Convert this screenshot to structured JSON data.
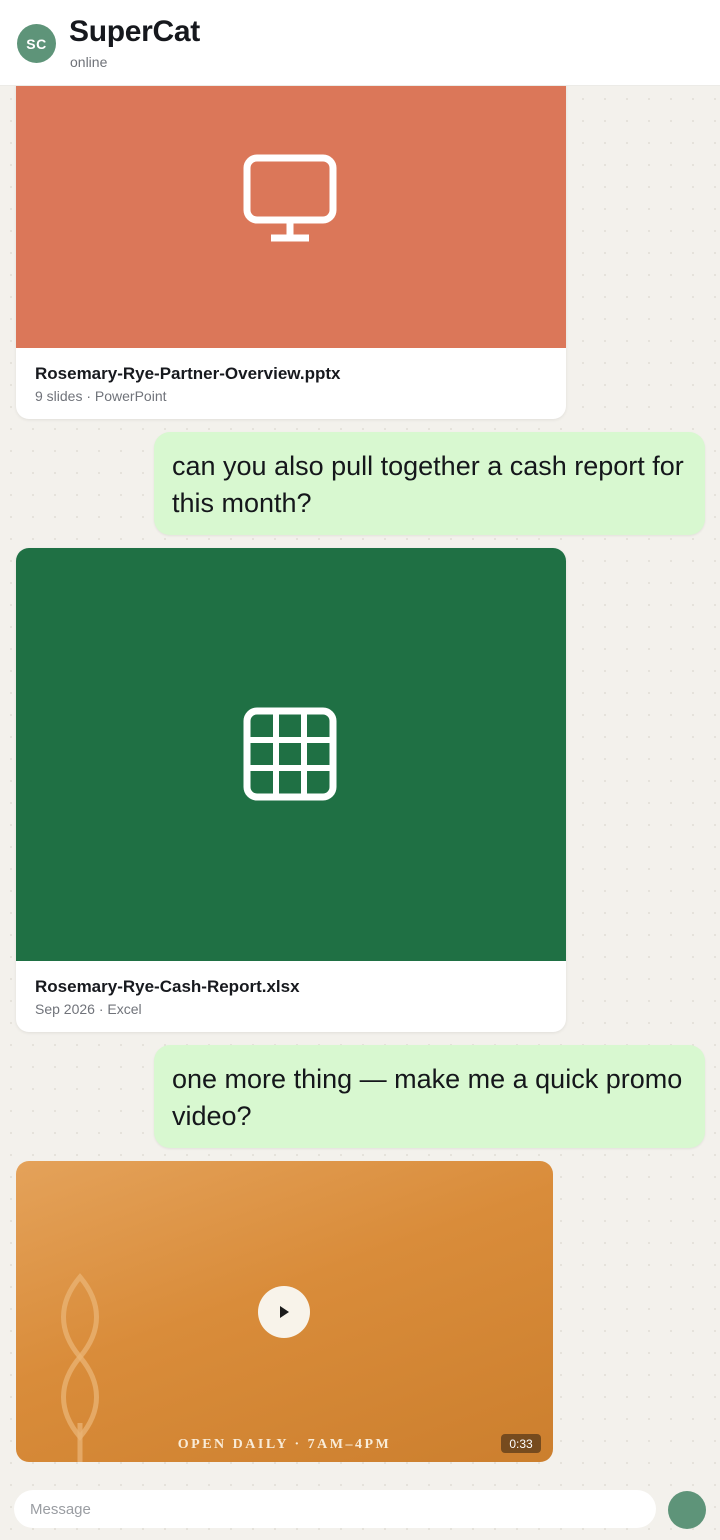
{
  "header": {
    "avatar_initials": "SC",
    "title": "SuperCat",
    "status": "online"
  },
  "messages": [
    {
      "type": "file",
      "file_name": "Rosemary-Rye-Partner-Overview.pptx",
      "file_meta": "9 slides · PowerPoint",
      "icon": "monitor-icon",
      "preview_color": "#db7759"
    },
    {
      "type": "text",
      "text": "can you also pull together a cash report for this month?"
    },
    {
      "type": "file",
      "file_name": "Rosemary-Rye-Cash-Report.xlsx",
      "file_meta": "Sep 2026 · Excel",
      "icon": "spreadsheet-grid-icon",
      "preview_color": "#1f7044"
    },
    {
      "type": "text",
      "text": "one more thing — make me a quick promo video?"
    },
    {
      "type": "video",
      "caption": "OPEN DAILY · 7AM–4PM",
      "duration": "0:33",
      "icon": "play-icon"
    }
  ],
  "composer": {
    "placeholder": "Message"
  },
  "colors": {
    "accent": "#5e9479",
    "outgoing_bubble": "#d8f8d0"
  }
}
